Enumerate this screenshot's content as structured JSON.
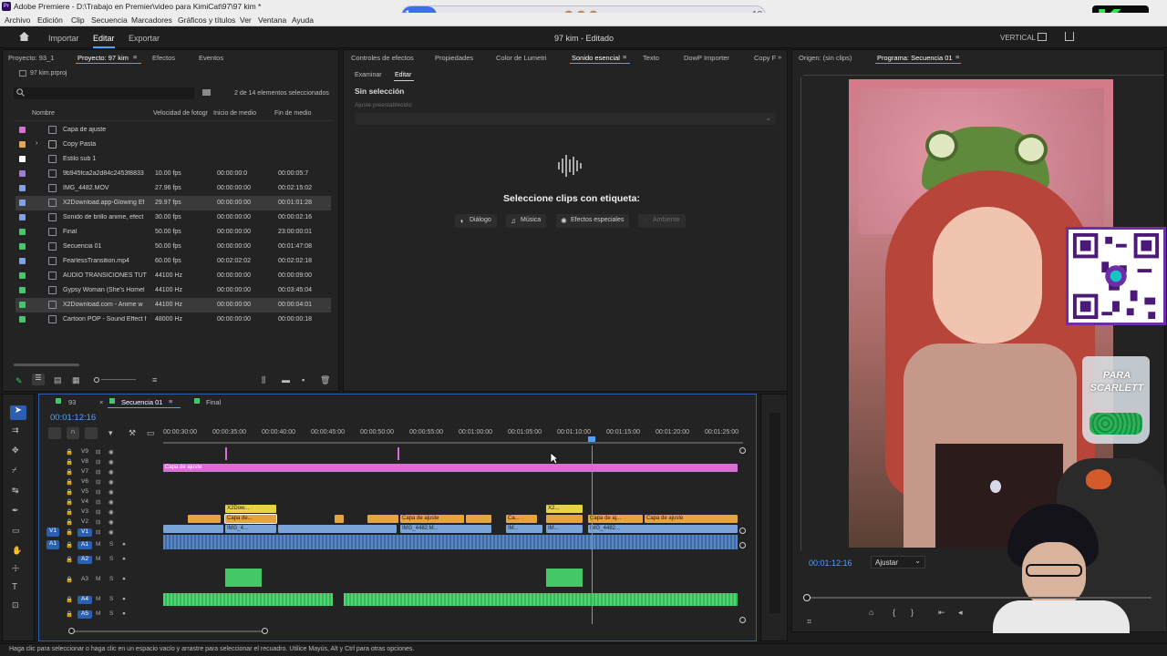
{
  "title_bar": {
    "title": "Adobe Premiere - D:\\Trabajo en Premier\\video para KimiCat\\97\\97 kim *",
    "app_icon": "Pr"
  },
  "menu": [
    "Archivo",
    "Edición",
    "Clip",
    "Secuencia",
    "Marcadores",
    "Gráficos y títulos",
    "Ver",
    "Ventana",
    "Ayuda"
  ],
  "overlay": {
    "left_counter": "1",
    "right_counter": "10",
    "emojis": "🙈🙈🙈",
    "badge_letter": "K",
    "badge_number": "1"
  },
  "workspace": {
    "home_icon": "home-icon",
    "tabs": [
      "Importar",
      "Editar",
      "Exportar"
    ],
    "active_tab": "Editar",
    "center_title": "97 kim - Editado",
    "right_label": "VERTICAL"
  },
  "project_panel": {
    "tabs": [
      "Proyecto: 93_1",
      "Proyecto: 97 kim",
      "Efectos",
      "Eventos"
    ],
    "file": "97 kim.prproj",
    "selection_info": "2 de 14 elementos seleccionados",
    "columns": [
      "Nombre",
      "Velocidad de fotogr",
      "Inicio de medio",
      "Fin de medio"
    ],
    "rows": [
      {
        "name": "Capa de ajuste",
        "fps": "",
        "start": "",
        "end": "",
        "color": "#d96fd4",
        "selected": false
      },
      {
        "name": "Copy Pasta",
        "fps": "",
        "start": "",
        "end": "",
        "color": "#e6a84a",
        "selected": false,
        "folder": true
      },
      {
        "name": "Estilo sub 1",
        "fps": "",
        "start": "",
        "end": "",
        "color": "#ffffff",
        "selected": false
      },
      {
        "name": "9b945fca2a2d84c2453f8833",
        "fps": "10.00 fps",
        "start": "00:00:00:0",
        "end": "00:00:05:7",
        "color": "#9b7ad8",
        "selected": false
      },
      {
        "name": "IMG_4482.MOV",
        "fps": "27.96 fps",
        "start": "00:00:00:00",
        "end": "00:02:15:02",
        "color": "#7aa4e6",
        "selected": false
      },
      {
        "name": "X2Download.app-Glowing Ef",
        "fps": "29.97 fps",
        "start": "00:00:00:00",
        "end": "00:01:01:28",
        "color": "#7aa4e6",
        "selected": true
      },
      {
        "name": "Sonido de brillo anime, efect",
        "fps": "30.00 fps",
        "start": "00:00:00:00",
        "end": "00:00:02:16",
        "color": "#7aa4e6",
        "selected": false
      },
      {
        "name": "Final",
        "fps": "50.00 fps",
        "start": "00:00:00:00",
        "end": "23:00:00:01",
        "color": "#44c767",
        "selected": false
      },
      {
        "name": "Secuencia 01",
        "fps": "50.00 fps",
        "start": "00:00:00:00",
        "end": "00:01:47:08",
        "color": "#44c767",
        "selected": false
      },
      {
        "name": "FearlessTransition.mp4",
        "fps": "60.00 fps",
        "start": "00:02:02:02",
        "end": "00:02:02:18",
        "color": "#7aa4e6",
        "selected": false
      },
      {
        "name": "AUDIO TRANSICIONES TUT",
        "fps": "44100 Hz",
        "start": "00:00:00:00",
        "end": "00:00:09:00",
        "color": "#44c767",
        "selected": false
      },
      {
        "name": "Gypsy Woman (She's Homel",
        "fps": "44100 Hz",
        "start": "00:00:00:00",
        "end": "00:03:45:04",
        "color": "#44c767",
        "selected": false
      },
      {
        "name": "X2Download.com - Anime w",
        "fps": "44100 Hz",
        "start": "00:00:00:00",
        "end": "00:00:04:01",
        "color": "#44c767",
        "selected": true
      },
      {
        "name": "Cartoon POP - Sound Effect f",
        "fps": "48000 Hz",
        "start": "00:00:00:00",
        "end": "00:00:00:18",
        "color": "#44c767",
        "selected": false
      }
    ]
  },
  "essential_panel": {
    "tabs": [
      "Controles de efectos",
      "Propiedades",
      "Color de Lumetri",
      "Sonido esencial",
      "Texto",
      "DowP Importer",
      "Copy F"
    ],
    "subtabs": [
      "Examinar",
      "Editar"
    ],
    "no_selection": "Sin selección",
    "preset_label": "Ajuste preestablecido:",
    "prompt": "Seleccione clips con etiqueta:",
    "tags": [
      {
        "label": "Diálogo",
        "glyph": "◖"
      },
      {
        "label": "Música",
        "glyph": "♫"
      },
      {
        "label": "Efectos especiales",
        "glyph": "✺"
      },
      {
        "label": "Ambiente",
        "glyph": "◌"
      }
    ]
  },
  "program_monitor": {
    "tabs": [
      "Origen: (sin clips)",
      "Programa: Secuencia 01"
    ],
    "timecode": "00:01:12:16",
    "fit": "Ajustar",
    "cup_text": "PARA SCARLETT"
  },
  "timeline": {
    "tabs": [
      "93",
      "Secuencia 01",
      "Final"
    ],
    "timecode": "00:01:12:16",
    "ruler": [
      "00:00:30:00",
      "00:00:35:00",
      "00:00:40:00",
      "00:00:45:00",
      "00:00:50:00",
      "00:00:55:00",
      "00:01:00:00",
      "00:01:05:00",
      "00:01:10:00",
      "00:01:15:00",
      "00:01:20:00",
      "00:01:25:00"
    ],
    "video_tracks": [
      "V9",
      "V8",
      "V7",
      "V6",
      "V5",
      "V4",
      "V3",
      "V2",
      "V1"
    ],
    "audio_tracks": [
      "A1",
      "A2",
      "A3",
      "A4",
      "A5"
    ],
    "clips": {
      "adjustment_v7": "Capa de ajuste",
      "x2dow": "X2Dow...",
      "capa_de": "Capa de...",
      "capa_ajuste_1": "Capa de ajuste",
      "ca": "Ca...",
      "x2": "X2...",
      "capa_aj": "Capa de aj...",
      "capa_ajuste_2": "Capa de ajuste",
      "img_1": "IMG_4...",
      "img_2": "IMG_4482.M...",
      "im_1": "IM...",
      "im_2": "IM...",
      "img_3": "IMG_4482..."
    }
  },
  "status_bar": "Haga clic para seleccionar o haga clic en un espacio vacío y arrastre para seleccionar el recuadro. Utilice Mayús, Alt y Ctrl para otras opciones."
}
